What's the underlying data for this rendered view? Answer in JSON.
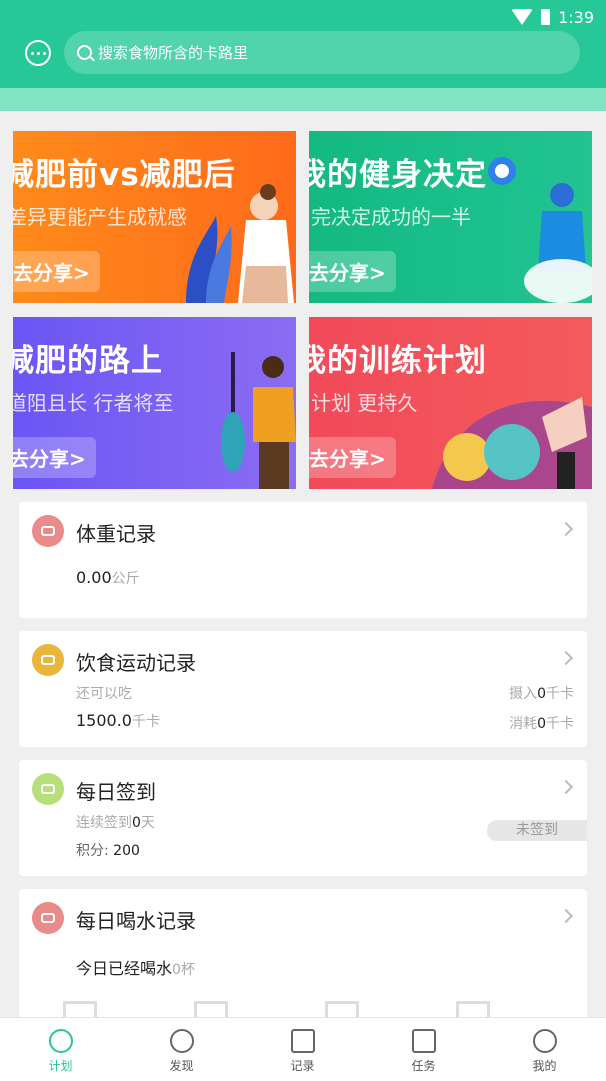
{
  "status_bar": {
    "time": "1:39"
  },
  "header": {
    "search_placeholder": "搜索食物所含的卡路里"
  },
  "banners": [
    {
      "title": "减肥前vs减肥后",
      "subtitle": "差异更能产生成就感",
      "button": "去分享>"
    },
    {
      "title": "我的健身决定",
      "subtitle": "完决定成功的一半",
      "button": "去分享>"
    },
    {
      "title": "减肥的路上",
      "subtitle": "道阻且长 行者将至",
      "button": "去分享>"
    },
    {
      "title": "我的训练计划",
      "subtitle": "计划 更持久",
      "button": "去分享>"
    }
  ],
  "weight": {
    "title": "体重记录",
    "value": "0.00",
    "unit": "公斤"
  },
  "diet": {
    "title": "饮食运动记录",
    "can_eat_label": "还可以吃",
    "can_eat_value": "1500.0",
    "can_eat_unit": "千卡",
    "intake_label": "摄入",
    "intake_value": "0",
    "intake_unit": "千卡",
    "burn_label": "消耗",
    "burn_value": "0",
    "burn_unit": "千卡"
  },
  "checkin": {
    "title": "每日签到",
    "streak_label": "连续签到",
    "streak_value": "0",
    "streak_unit": "天",
    "points_label": "积分:",
    "points_value": "200",
    "status": "未签到"
  },
  "water": {
    "title": "每日喝水记录",
    "label": "今日已经喝水",
    "value": "0",
    "unit": "杯"
  },
  "tabs": [
    {
      "label": "计划",
      "icon": "plan-icon",
      "active": true
    },
    {
      "label": "发现",
      "icon": "compass-icon",
      "active": false
    },
    {
      "label": "记录",
      "icon": "record-icon",
      "active": false
    },
    {
      "label": "任务",
      "icon": "task-icon",
      "active": false
    },
    {
      "label": "我的",
      "icon": "profile-icon",
      "active": false
    }
  ],
  "colors": {
    "primary": "#26c897",
    "banner1": "#ff8c1a",
    "banner2": "#1dbf86",
    "banner3": "#7b5cf0",
    "banner4": "#f2505a"
  }
}
